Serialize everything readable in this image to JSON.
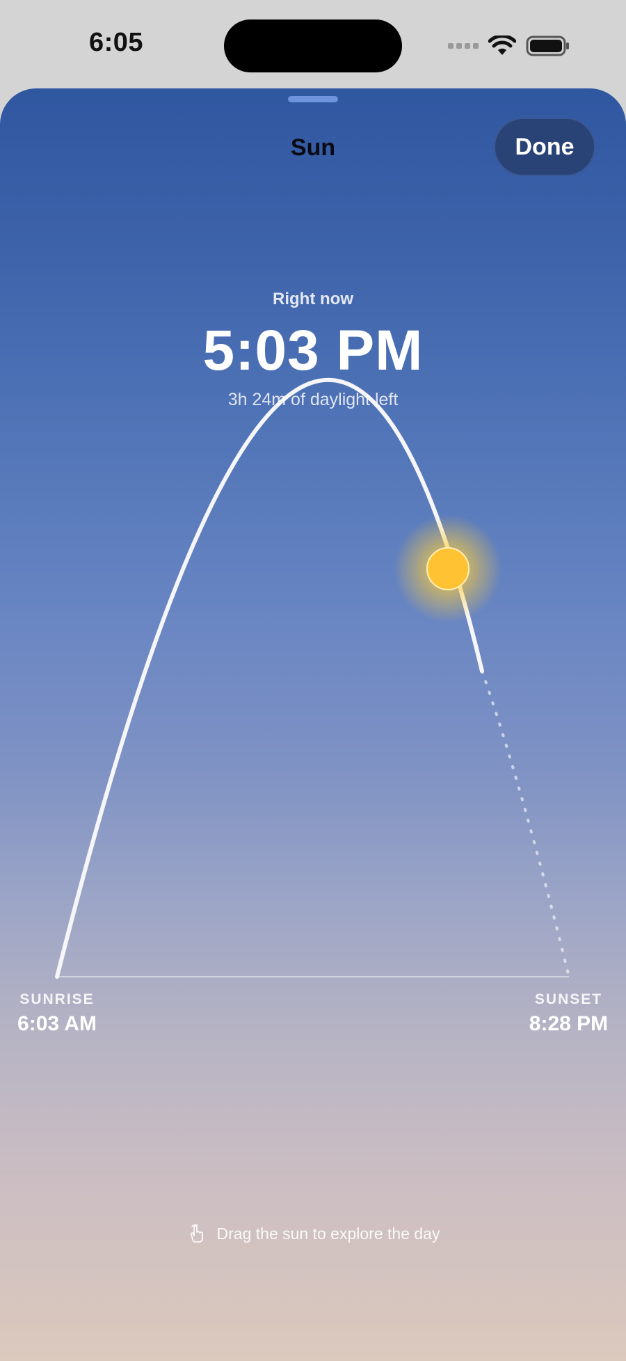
{
  "status_bar": {
    "time": "6:05"
  },
  "sheet": {
    "title": "Sun",
    "done_label": "Done"
  },
  "current": {
    "caption": "Right now",
    "time": "5:03 PM",
    "daylight_left": "3h 24m of daylight left"
  },
  "sunrise": {
    "caption": "SUNRISE",
    "time": "6:03 AM"
  },
  "sunset": {
    "caption": "SUNSET",
    "time": "8:28 PM"
  },
  "hint": {
    "text": "Drag the sun to explore the day"
  },
  "colors": {
    "sun": "#ffc233",
    "path": "#ffffff",
    "done_button": "#2a4377"
  }
}
